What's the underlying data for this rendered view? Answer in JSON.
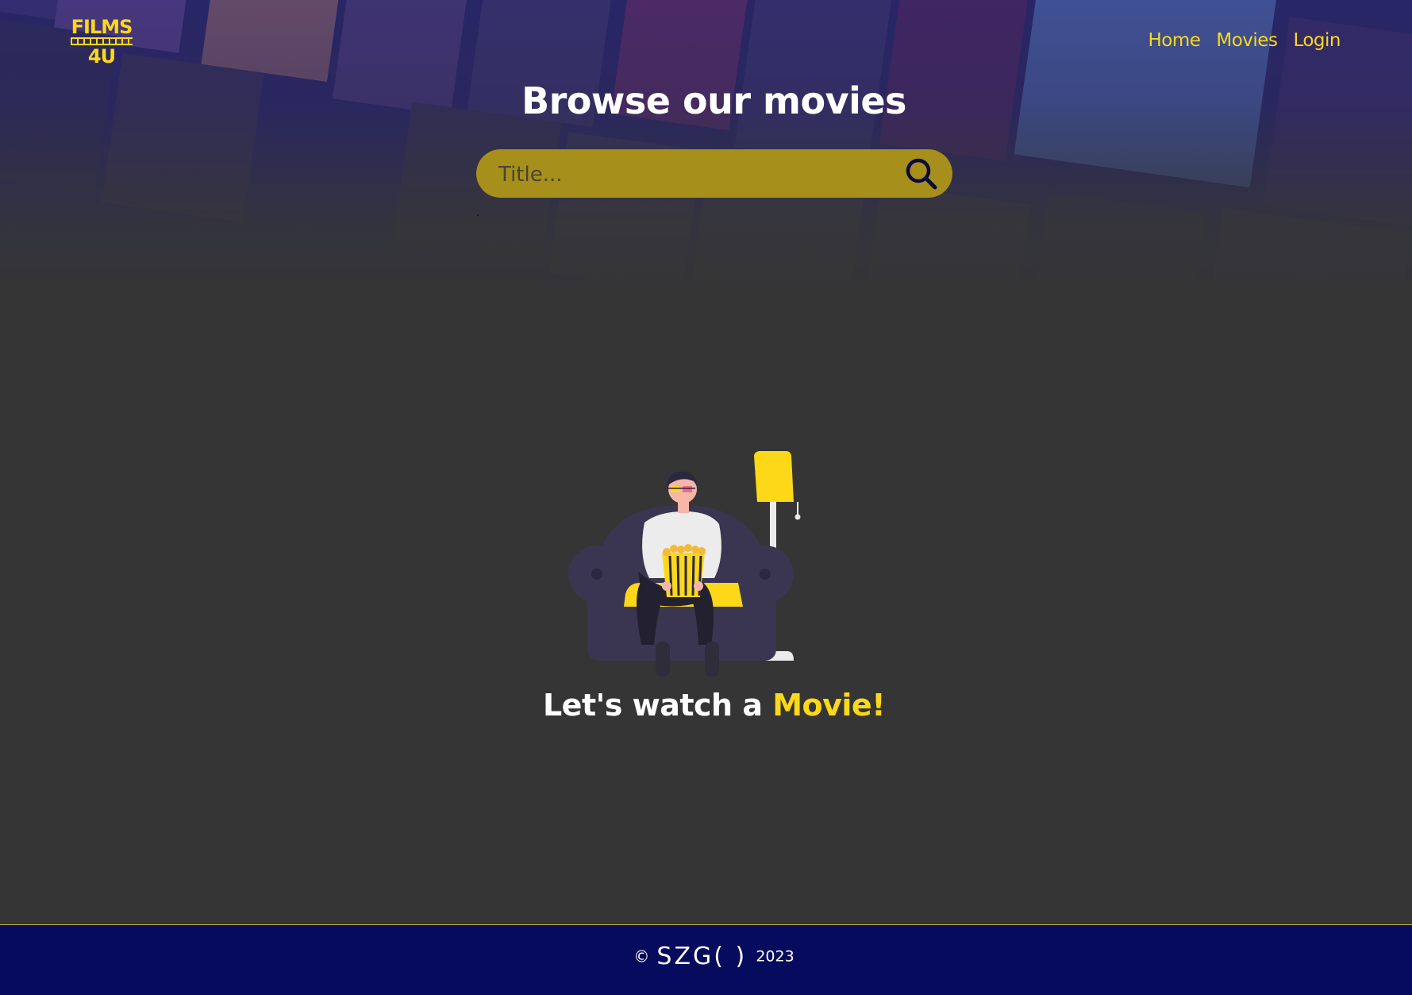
{
  "logo": {
    "line1": "FILMS",
    "line2": "4U"
  },
  "nav": {
    "items": [
      {
        "label": "Home"
      },
      {
        "label": "Movies"
      },
      {
        "label": "Login"
      }
    ]
  },
  "hero": {
    "title": "Browse our movies",
    "search": {
      "placeholder": "Title...",
      "value": "",
      "icon": "search-icon"
    }
  },
  "main": {
    "illustration_icon": "person-on-couch-with-popcorn-illustration",
    "tagline_prefix": "Let's watch a ",
    "tagline_accent": "Movie!"
  },
  "footer": {
    "copyright_symbol": "©",
    "brand": "SZG( )",
    "year": "2023"
  },
  "colors": {
    "accent": "#fdd819",
    "background": "#353535",
    "footer_bg": "#070b5d",
    "search_bg": "#a68f1a"
  }
}
